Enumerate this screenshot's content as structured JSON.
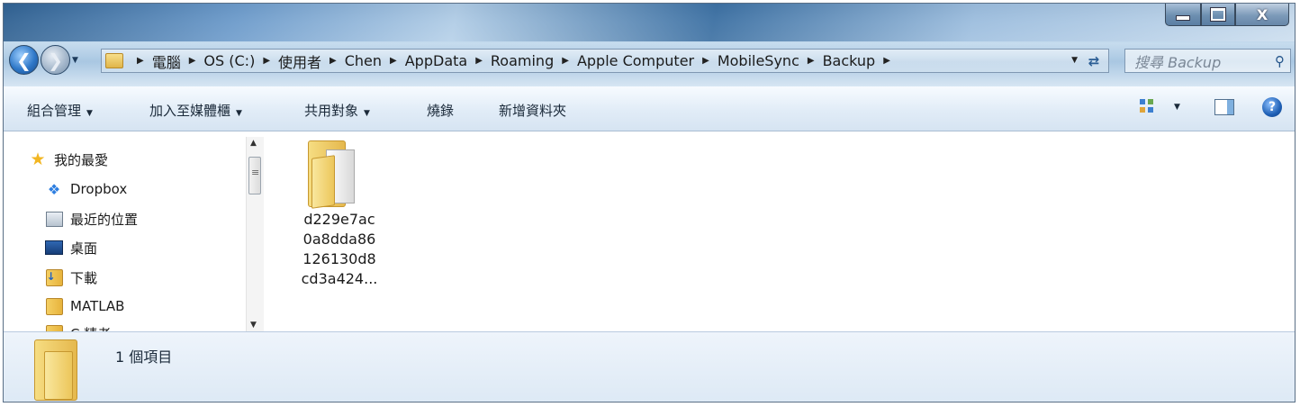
{
  "window": {
    "caption_buttons": {
      "minimize": "minimize-icon",
      "maximize": "maximize-icon",
      "close_label": "X"
    }
  },
  "navigation": {
    "back_icon": "back-arrow-icon",
    "forward_icon": "forward-arrow-icon"
  },
  "address_bar": {
    "breadcrumbs": [
      "電腦",
      "OS (C:)",
      "使用者",
      "Chen",
      "AppData",
      "Roaming",
      "Apple Computer",
      "MobileSync",
      "Backup"
    ]
  },
  "search": {
    "placeholder": "搜尋 Backup"
  },
  "toolbar": {
    "organize": "組合管理",
    "add_to_library": "加入至媒體櫃",
    "share_with": "共用對象",
    "burn": "燒錄",
    "new_folder": "新增資料夾"
  },
  "sidebar": {
    "items": [
      {
        "label": "我的最愛",
        "icon": "star-icon"
      },
      {
        "label": "Dropbox",
        "icon": "dropbox-icon"
      },
      {
        "label": "最近的位置",
        "icon": "recent-places-icon"
      },
      {
        "label": "桌面",
        "icon": "desktop-icon"
      },
      {
        "label": "下載",
        "icon": "downloads-folder-icon"
      },
      {
        "label": "MATLAB",
        "icon": "folder-icon"
      },
      {
        "label": "C 精者",
        "icon": "folder-icon"
      }
    ]
  },
  "content": {
    "folder_name_lines": [
      "d229e7ac",
      "0a8dda86",
      "126130d8",
      "cd3a424..."
    ]
  },
  "details": {
    "item_count": "1 個項目"
  },
  "colors": {
    "accent": "#2f78c8",
    "chrome": "#d6e4f2"
  }
}
